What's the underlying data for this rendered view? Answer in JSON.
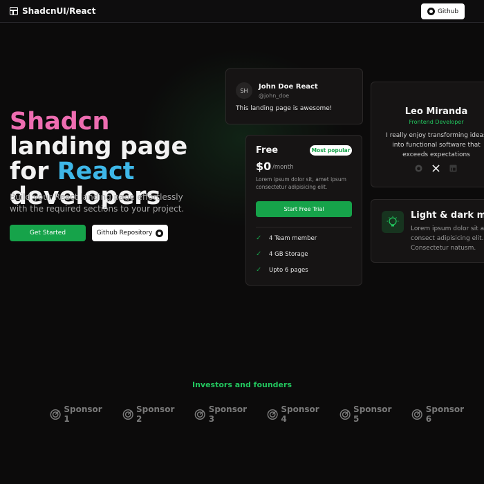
{
  "nav": {
    "brand": "ShadcnUI/React",
    "github_label": "Github"
  },
  "hero": {
    "title_part1": "Shadcn",
    "title_part2": " landing page for ",
    "title_part3": "React",
    "title_part4": " developers",
    "subtitle": "Build your React landing page effortlessly with the required sections to your project.",
    "cta_primary": "Get Started",
    "cta_secondary": "Github Repository"
  },
  "testimonial": {
    "initials": "SH",
    "name": "John Doe React",
    "handle": "@john_doe",
    "text": "This landing page is awesome!"
  },
  "pricing": {
    "plan": "Free",
    "badge": "Most popular",
    "price": "$0",
    "period": "/month",
    "description": "Lorem ipsum dolor sit, amet ipsum consectetur adipisicing elit.",
    "button": "Start Free Trial",
    "features": [
      "4 Team member",
      "4 GB Storage",
      "Upto 6 pages"
    ]
  },
  "team": {
    "name": "Leo Miranda",
    "role": "Frontend Developer",
    "bio": "I really enjoy transforming ideas into functional software that exceeds expectations",
    "socials": [
      "github-icon",
      "x-icon",
      "linkedin-icon"
    ]
  },
  "feature": {
    "title": "Light & dark mode",
    "description_lines": [
      "Lorem ipsum dolor sit amet",
      "consect adipisicing elit.",
      "Consectetur natusm."
    ]
  },
  "sponsors": {
    "heading": "Investors and founders",
    "items": [
      "Sponsor 1",
      "Sponsor 2",
      "Sponsor 3",
      "Sponsor 4",
      "Sponsor 5",
      "Sponsor 6"
    ]
  },
  "colors": {
    "accent": "#16a34a",
    "pink": "#ee6db1",
    "blue": "#3eb7e8",
    "background": "#0c0b0b"
  }
}
